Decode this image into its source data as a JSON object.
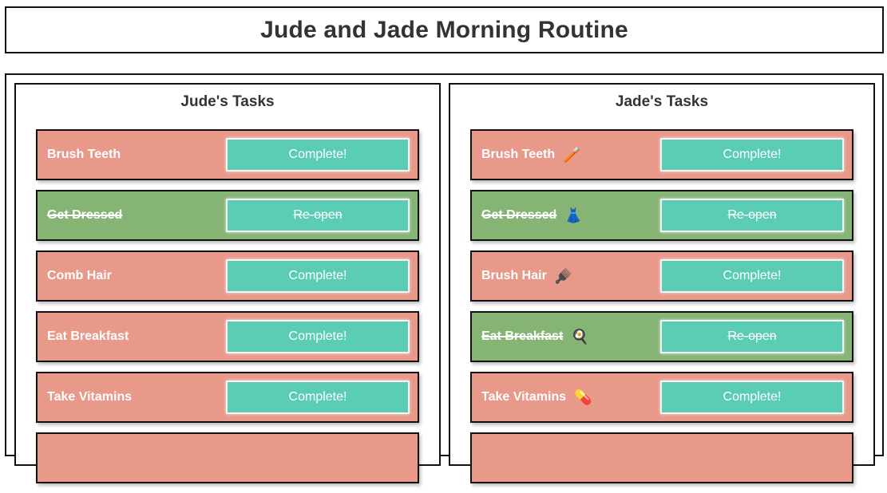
{
  "page": {
    "title": "Jude and Jade Morning Routine"
  },
  "colors": {
    "open": "#e8998a",
    "done": "#85b475",
    "button": "#5bcdb4"
  },
  "jude": {
    "heading": "Jude's Tasks",
    "tasks": [
      {
        "name": "Brush Teeth",
        "emoji": "",
        "button": "Complete!",
        "state": "open"
      },
      {
        "name": "Get Dressed",
        "emoji": "",
        "button": "Re-open",
        "state": "done"
      },
      {
        "name": "Comb Hair",
        "emoji": "",
        "button": "Complete!",
        "state": "open"
      },
      {
        "name": "Eat Breakfast",
        "emoji": "",
        "button": "Complete!",
        "state": "open"
      },
      {
        "name": "Take Vitamins",
        "emoji": "",
        "button": "Complete!",
        "state": "open"
      },
      {
        "name": "",
        "emoji": "",
        "button": "",
        "state": "open"
      }
    ]
  },
  "jade": {
    "heading": "Jade's Tasks",
    "tasks": [
      {
        "name": "Brush Teeth",
        "emoji": "🪥",
        "button": "Complete!",
        "state": "open"
      },
      {
        "name": "Get Dressed",
        "emoji": "👗",
        "button": "Re-open",
        "state": "done"
      },
      {
        "name": "Brush Hair",
        "emoji": "🪮",
        "button": "Complete!",
        "state": "open"
      },
      {
        "name": "Eat Breakfast",
        "emoji": "🍳",
        "button": "Re-open",
        "state": "done"
      },
      {
        "name": "Take Vitamins",
        "emoji": "💊",
        "button": "Complete!",
        "state": "open"
      },
      {
        "name": "",
        "emoji": "",
        "button": "",
        "state": "open"
      }
    ]
  }
}
